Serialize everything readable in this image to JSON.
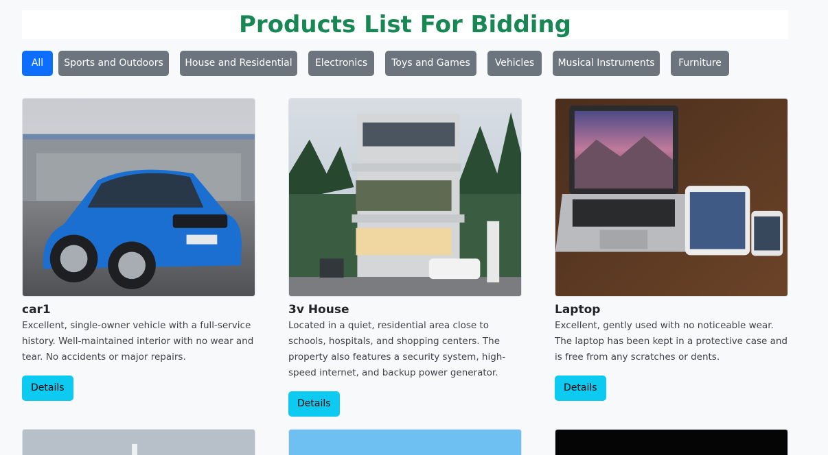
{
  "page": {
    "title": "Products List For Bidding"
  },
  "categories": [
    {
      "label": "All",
      "active": true
    },
    {
      "label": "Sports and Outdoors",
      "active": false
    },
    {
      "label": "House and Residential",
      "active": false
    },
    {
      "label": "Electronics",
      "active": false
    },
    {
      "label": "Toys and Games",
      "active": false
    },
    {
      "label": "Vehicles",
      "active": false
    },
    {
      "label": "Musical Instruments",
      "active": false
    },
    {
      "label": "Furniture",
      "active": false
    }
  ],
  "products": [
    {
      "name": "car1",
      "description": "Excellent, single-owner vehicle with a full-service history. Well-maintained interior with no wear and tear. No accidents or major repairs.",
      "button": "Details",
      "image": "blue-car-photo"
    },
    {
      "name": "3v House",
      "description": "Located in a quiet, residential area close to schools, hospitals, and shopping centers. The property also features a security system, high-speed internet, and backup power generator.",
      "button": "Details",
      "image": "modern-house-photo"
    },
    {
      "name": "Laptop",
      "description": "Excellent, gently used with no noticeable wear. The laptop has been kept in a protective case and is free from any scratches or dents.",
      "button": "Details",
      "image": "laptop-tablet-phone-photo"
    }
  ],
  "colors": {
    "title": "#198754",
    "active_category": "#0d6efd",
    "category": "#6c757d",
    "details_button": "#0dcaf0"
  }
}
